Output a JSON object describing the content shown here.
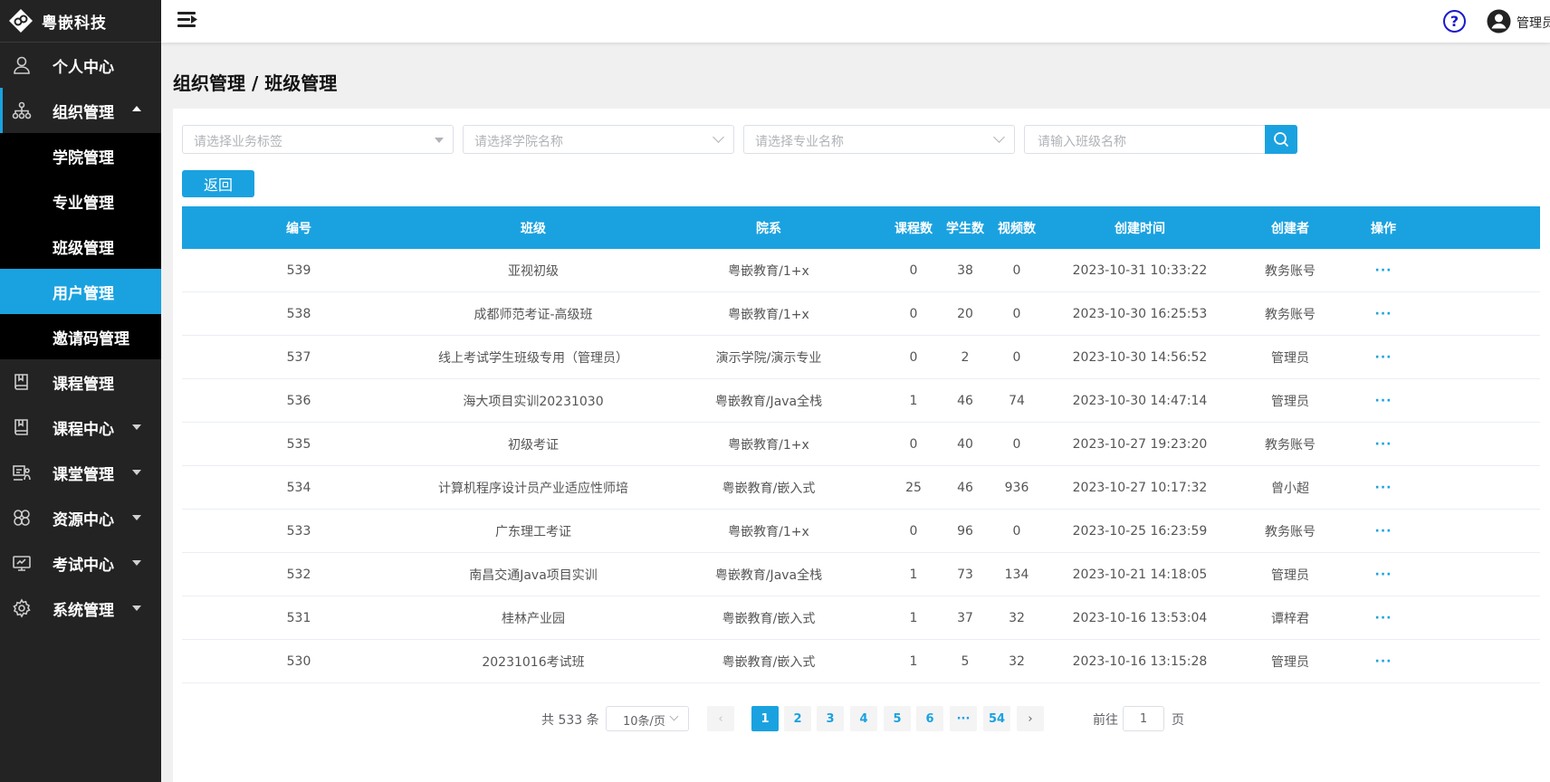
{
  "brand": {
    "name": "粤嵌科技"
  },
  "sidebar": {
    "items": [
      {
        "label": "个人中心",
        "icon": "user-icon"
      },
      {
        "label": "组织管理",
        "icon": "org-tree-icon",
        "expanded": true,
        "children": [
          {
            "label": "学院管理"
          },
          {
            "label": "专业管理"
          },
          {
            "label": "班级管理"
          },
          {
            "label": "用户管理",
            "active": true
          },
          {
            "label": "邀请码管理"
          }
        ]
      },
      {
        "label": "课程管理",
        "icon": "book-icon"
      },
      {
        "label": "课程中心",
        "icon": "book-icon",
        "has_children": true
      },
      {
        "label": "课堂管理",
        "icon": "classroom-icon",
        "has_children": true
      },
      {
        "label": "资源中心",
        "icon": "resource-icon",
        "has_children": true
      },
      {
        "label": "考试中心",
        "icon": "monitor-icon",
        "has_children": true
      },
      {
        "label": "系统管理",
        "icon": "gear-icon",
        "has_children": true
      }
    ]
  },
  "header": {
    "help": "?",
    "user_name": "管理员"
  },
  "breadcrumb": "组织管理 / 班级管理",
  "filters": {
    "tag_placeholder": "请选择业务标签",
    "college_placeholder": "请选择学院名称",
    "major_placeholder": "请选择专业名称",
    "class_placeholder": "请输入班级名称"
  },
  "back_label": "返回",
  "table": {
    "columns": [
      "编号",
      "班级",
      "院系",
      "课程数",
      "学生数",
      "视频数",
      "创建时间",
      "创建者",
      "操作"
    ],
    "rows": [
      {
        "id": "539",
        "name": "亚视初级",
        "dept": "粤嵌教育/1+x",
        "courses": "0",
        "students": "38",
        "videos": "0",
        "created": "2023-10-31 10:33:22",
        "creator": "教务账号",
        "op": "···"
      },
      {
        "id": "538",
        "name": "成都师范考证-高级班",
        "dept": "粤嵌教育/1+x",
        "courses": "0",
        "students": "20",
        "videos": "0",
        "created": "2023-10-30 16:25:53",
        "creator": "教务账号",
        "op": "···"
      },
      {
        "id": "537",
        "name": "线上考试学生班级专用（管理员）",
        "dept": "演示学院/演示专业",
        "courses": "0",
        "students": "2",
        "videos": "0",
        "created": "2023-10-30 14:56:52",
        "creator": "管理员",
        "op": "···"
      },
      {
        "id": "536",
        "name": "海大项目实训20231030",
        "dept": "粤嵌教育/Java全栈",
        "courses": "1",
        "students": "46",
        "videos": "74",
        "created": "2023-10-30 14:47:14",
        "creator": "管理员",
        "op": "···"
      },
      {
        "id": "535",
        "name": "初级考证",
        "dept": "粤嵌教育/1+x",
        "courses": "0",
        "students": "40",
        "videos": "0",
        "created": "2023-10-27 19:23:20",
        "creator": "教务账号",
        "op": "···"
      },
      {
        "id": "534",
        "name": "计算机程序设计员产业适应性师培",
        "dept": "粤嵌教育/嵌入式",
        "courses": "25",
        "students": "46",
        "videos": "936",
        "created": "2023-10-27 10:17:32",
        "creator": "曾小超",
        "op": "···"
      },
      {
        "id": "533",
        "name": "广东理工考证",
        "dept": "粤嵌教育/1+x",
        "courses": "0",
        "students": "96",
        "videos": "0",
        "created": "2023-10-25 16:23:59",
        "creator": "教务账号",
        "op": "···"
      },
      {
        "id": "532",
        "name": "南昌交通Java项目实训",
        "dept": "粤嵌教育/Java全栈",
        "courses": "1",
        "students": "73",
        "videos": "134",
        "created": "2023-10-21 14:18:05",
        "creator": "管理员",
        "op": "···"
      },
      {
        "id": "531",
        "name": "桂林产业园",
        "dept": "粤嵌教育/嵌入式",
        "courses": "1",
        "students": "37",
        "videos": "32",
        "created": "2023-10-16 13:53:04",
        "creator": "谭梓君",
        "op": "···"
      },
      {
        "id": "530",
        "name": "20231016考试班",
        "dept": "粤嵌教育/嵌入式",
        "courses": "1",
        "students": "5",
        "videos": "32",
        "created": "2023-10-16 13:15:28",
        "creator": "管理员",
        "op": "···"
      }
    ]
  },
  "pagination": {
    "total_text": "共 533 条",
    "page_size": "10条/页",
    "prev": "‹",
    "next": "›",
    "pages": [
      "1",
      "2",
      "3",
      "4",
      "5",
      "6",
      "···",
      "54"
    ],
    "current": "1",
    "goto_prefix": "前往",
    "goto_value": "1",
    "goto_suffix": "页"
  },
  "colors": {
    "accent": "#1aa2e0",
    "sidebar_bg": "#232323",
    "submenu_bg": "#000000"
  }
}
